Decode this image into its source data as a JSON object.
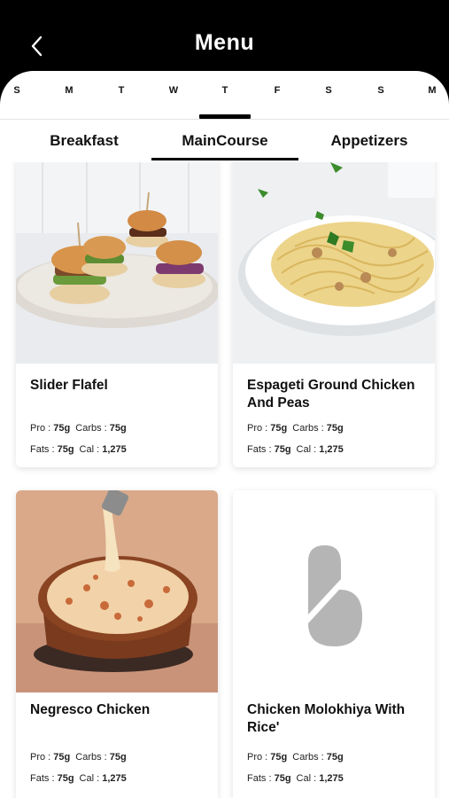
{
  "header": {
    "title": "Menu",
    "back_icon": "chevron-left-icon"
  },
  "days": [
    "S",
    "M",
    "T",
    "W",
    "T",
    "F",
    "S",
    "S",
    "M"
  ],
  "selected_day_index": 4,
  "tabs": [
    "Breakfast",
    "MainCourse",
    "Appetizers"
  ],
  "selected_tab_index": 1,
  "macro_labels": {
    "pro": "Pro :",
    "carbs": "Carbs :",
    "fats": "Fats :",
    "cal": "Cal :"
  },
  "items": [
    {
      "name": "Slider Flafel",
      "image": "sliders-photo",
      "pro": "75g",
      "carbs": "75g",
      "fats": "75g",
      "cal": "1,275"
    },
    {
      "name": "Espageti Ground Chicken And Peas",
      "image": "spaghetti-photo",
      "pro": "75g",
      "carbs": "75g",
      "fats": "75g",
      "cal": "1,275"
    },
    {
      "name": "Negresco Chicken",
      "image": "negresco-photo",
      "pro": "75g",
      "carbs": "75g",
      "fats": "75g",
      "cal": "1,275"
    },
    {
      "name": "Chicken Molokhiya With Rice'",
      "image": "placeholder-logo",
      "pro": "75g",
      "carbs": "75g",
      "fats": "75g",
      "cal": "1,275"
    }
  ],
  "colors": {
    "header_bg": "#000000",
    "accent": "#000000",
    "placeholder_logo": "#b5b5b5"
  }
}
